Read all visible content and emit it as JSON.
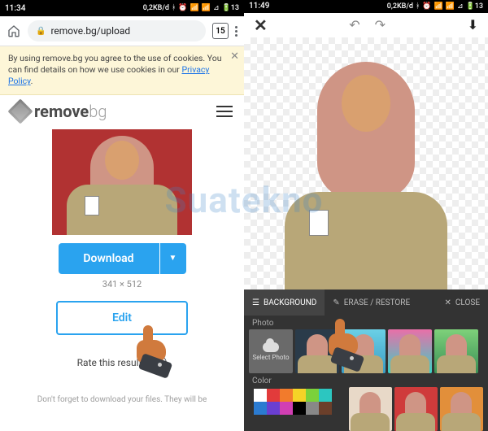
{
  "left": {
    "status": {
      "time": "11:34",
      "net": "0,2KB/d",
      "battery": "13"
    },
    "url": "remove.bg/upload",
    "tab_count": "15",
    "cookie": {
      "text_a": "By using remove.bg you agree to the use of cookies. You can find details on how we use cookies in our ",
      "link": "Privacy Policy",
      "text_b": "."
    },
    "brand": {
      "a": "remove",
      "b": "bg"
    },
    "download_label": "Download",
    "dimensions": "341 × 512",
    "edit_label": "Edit",
    "rate_label": "Rate this result:",
    "footnote": "Don't forget to download your files. They will be"
  },
  "right": {
    "status": {
      "time": "11:49",
      "net": "0,2KB/d",
      "battery": "13"
    },
    "tabs": {
      "background": "BACKGROUND",
      "erase": "ERASE / RESTORE",
      "close": "CLOSE"
    },
    "section_photo": "Photo",
    "select_photo": "Select Photo",
    "section_color": "Color",
    "colors": [
      "#ffffff",
      "#e23b3b",
      "#f27b2c",
      "#f5d327",
      "#7bd13a",
      "#2cc6c0",
      "#2b7bd1",
      "#6a3fd1",
      "#d13fb3",
      "#000000",
      "#888888",
      "#6b3f2a"
    ]
  },
  "watermark": "Suatekno"
}
